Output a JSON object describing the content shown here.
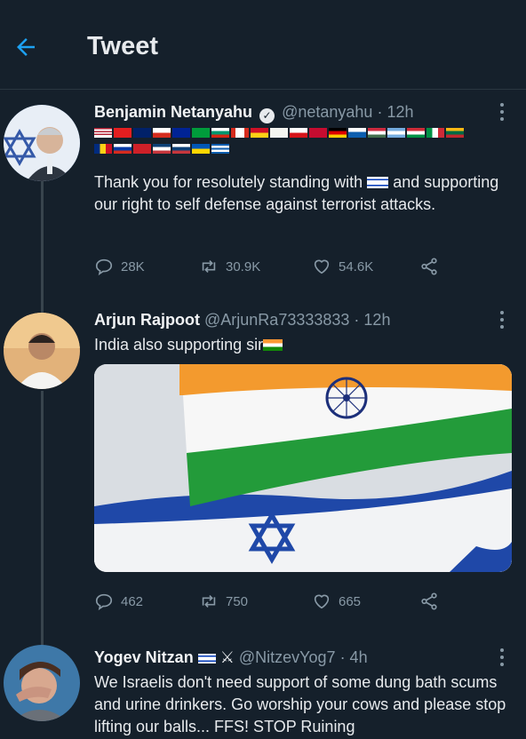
{
  "header": {
    "title": "Tweet"
  },
  "tweets": [
    {
      "name": "Benjamin Netanyahu",
      "handle": "@netanyahu",
      "time": "· 12h",
      "text_before": "Thank you for resolutely standing with",
      "text_after": "and supporting our right to self defense against terrorist attacks.",
      "replies": "28K",
      "retweets": "30.9K",
      "likes": "54.6K"
    },
    {
      "name": "Arjun Rajpoot",
      "handle": "@ArjunRa73333833",
      "time": "· 12h",
      "text": "India also supporting sir",
      "replies": "462",
      "retweets": "750",
      "likes": "665"
    },
    {
      "name": "Yogev Nitzan",
      "handle": "@NitzevYog7",
      "time": "· 4h",
      "text": "We Israelis don't need support of some dung bath scums and urine drinkers. Go worship your cows and please stop lifting our balls... FFS! STOP Ruining"
    }
  ],
  "colors": {
    "background": "#15202b",
    "accent": "#1da1f2",
    "muted": "#8899a6"
  },
  "icons": [
    "back-arrow-icon",
    "verified-icon",
    "more-icon",
    "reply-icon",
    "retweet-icon",
    "like-icon",
    "share-icon"
  ]
}
